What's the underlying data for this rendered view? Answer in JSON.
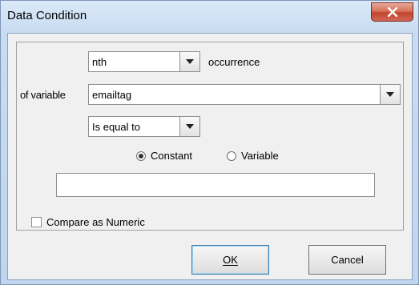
{
  "window": {
    "title": "Data Condition"
  },
  "position_select": {
    "value": "nth",
    "suffix_label": "occurrence"
  },
  "variable_row": {
    "label": "of variable",
    "value": "emailtag"
  },
  "operator_select": {
    "value": "Is equal to"
  },
  "compare_type": {
    "options": [
      "Constant",
      "Variable"
    ],
    "selected": "Constant"
  },
  "value_input": {
    "value": ""
  },
  "numeric_checkbox": {
    "label": "Compare as Numeric",
    "checked": false
  },
  "buttons": {
    "ok": "OK",
    "cancel": "Cancel"
  }
}
